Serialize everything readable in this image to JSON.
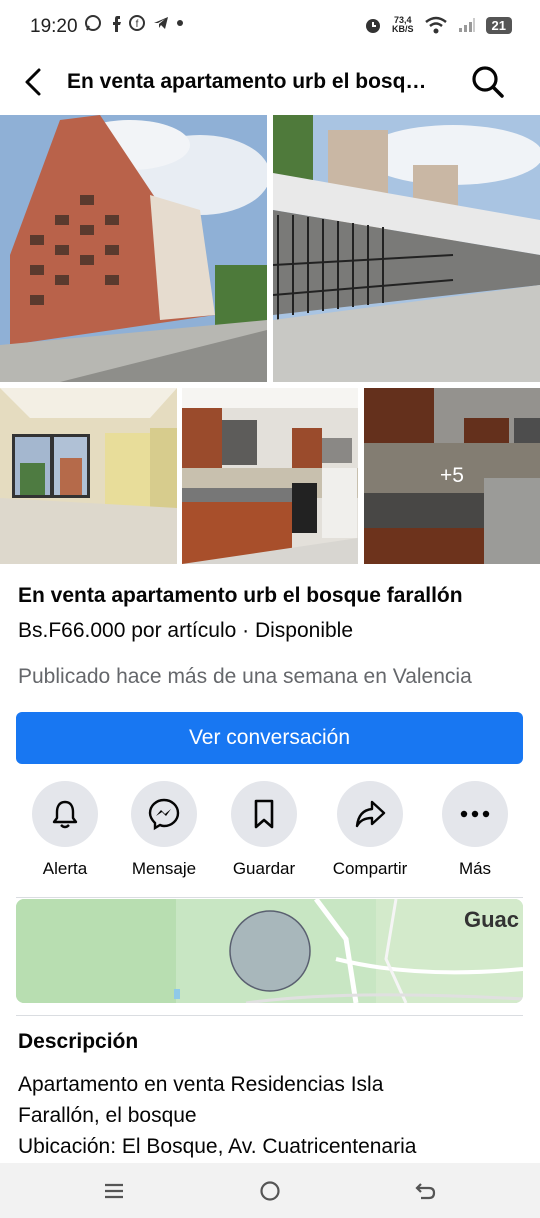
{
  "status_bar": {
    "time": "19:20",
    "net_speed_value": "73,4",
    "net_speed_unit": "KB/S",
    "battery": "21",
    "left_icons": [
      "whatsapp-icon",
      "facebook-icon",
      "messenger-icon",
      "telegram-icon",
      "dot-icon"
    ],
    "right_icons": [
      "alarm-icon",
      "wifi-icon",
      "signal-icon",
      "battery-icon"
    ]
  },
  "header": {
    "title": "En venta apartamento urb el bosque farallón"
  },
  "gallery": {
    "photos": [
      "photo-building-exterior",
      "photo-parking-gate",
      "photo-living-room",
      "photo-kitchen",
      "photo-kitchen-detail"
    ],
    "more_count": "+5"
  },
  "listing": {
    "title": "En venta apartamento urb el bosque farallón",
    "price_line": "Bs.F66.000 por artículo · Disponible",
    "posted": "Publicado hace más de una semana en Valencia"
  },
  "cta": {
    "label": "Ver conversación"
  },
  "actions": [
    {
      "label": "Alerta",
      "icon": "bell-icon"
    },
    {
      "label": "Mensaje",
      "icon": "messenger-icon"
    },
    {
      "label": "Guardar",
      "icon": "bookmark-icon"
    },
    {
      "label": "Compartir",
      "icon": "share-icon"
    },
    {
      "label": "Más",
      "icon": "more-icon"
    }
  ],
  "map": {
    "label": "Guac"
  },
  "description": {
    "heading": "Descripción",
    "lines": [
      "Apartamento en venta Residencias Isla",
      "Farallón, el bosque",
      "Ubicación: El Bosque, Av. Cuatricentenaria"
    ]
  },
  "colors": {
    "accent": "#1877f2",
    "secondary_text": "#65676b",
    "button_bg": "#e4e6eb"
  }
}
